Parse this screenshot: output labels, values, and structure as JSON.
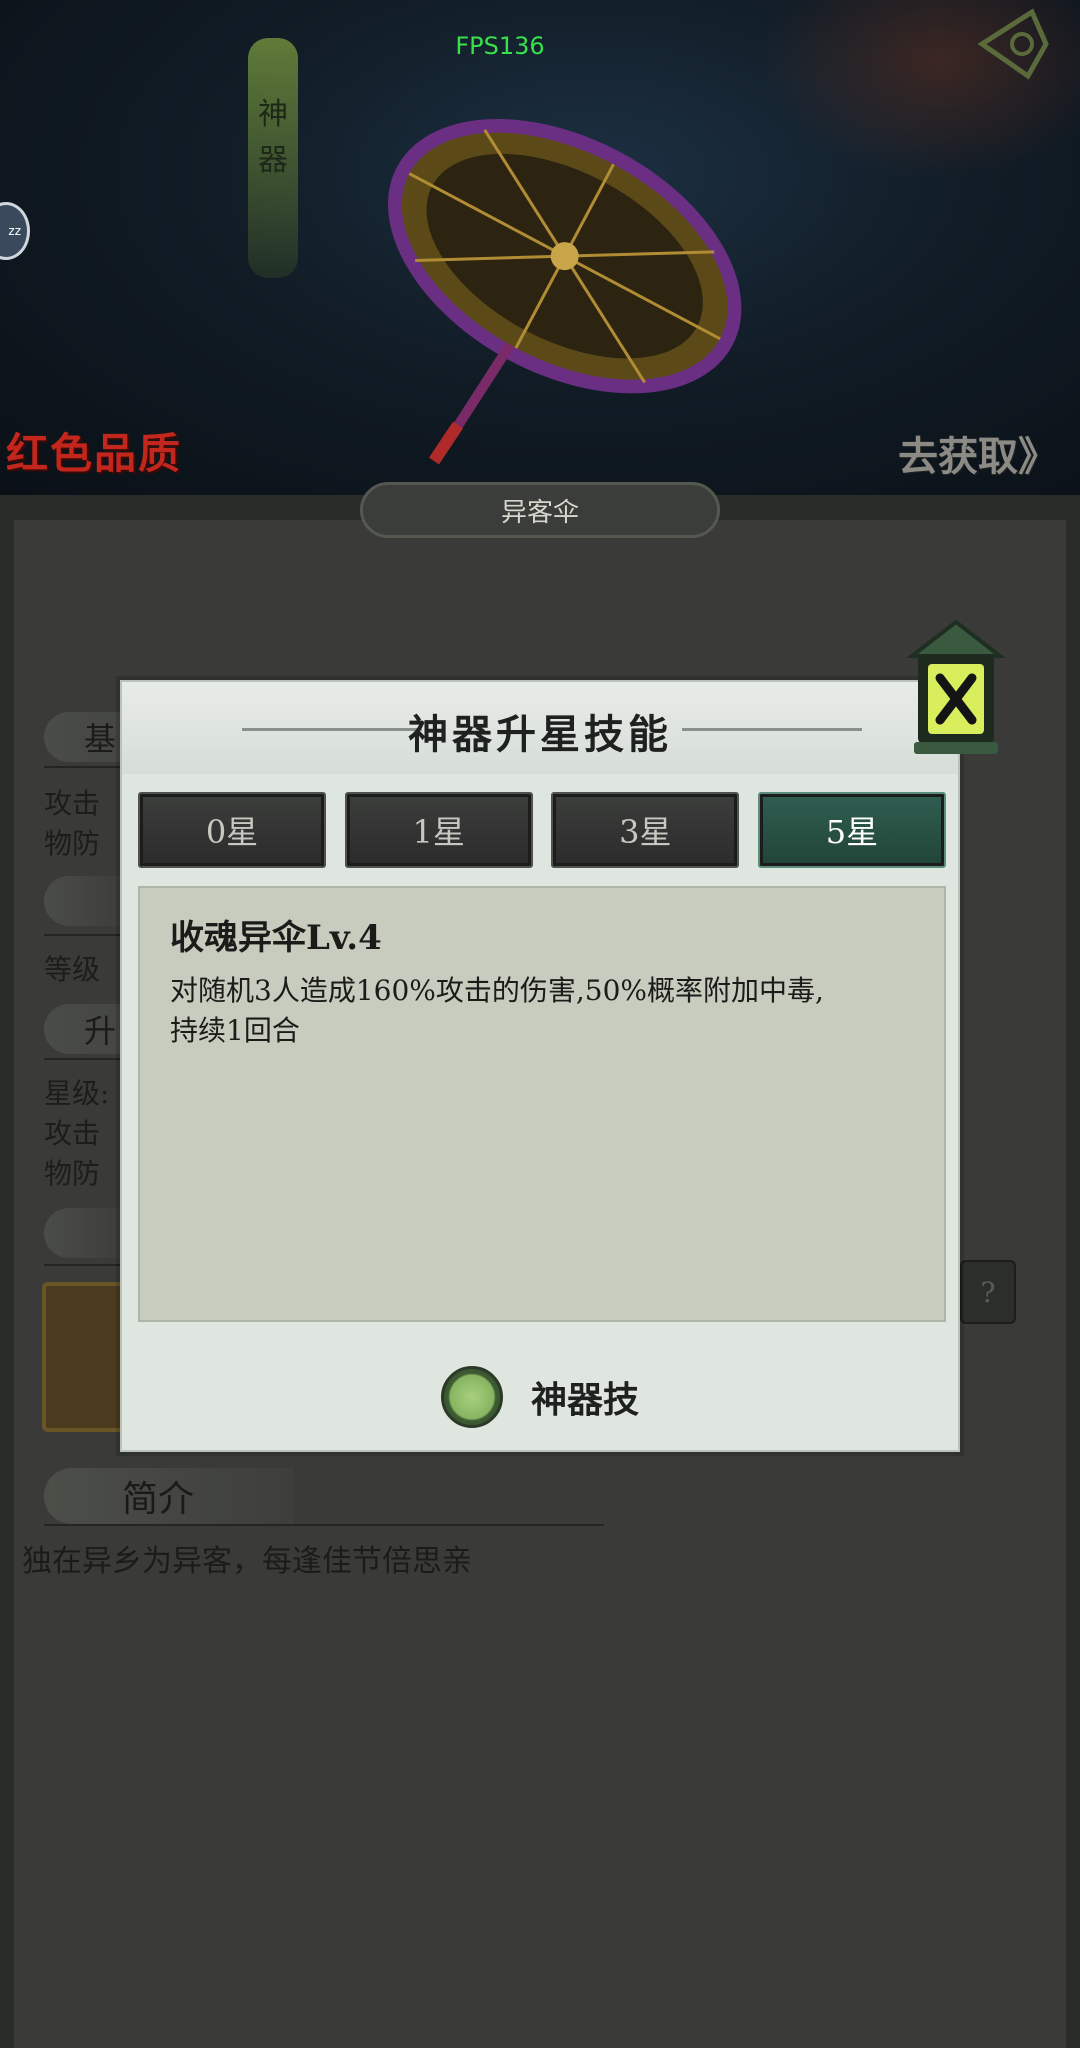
{
  "hud": {
    "fps": "FPS136"
  },
  "artwork": {
    "banner": [
      "神",
      "器"
    ],
    "quality_label": "红色品质",
    "go_get_label": "去获取》",
    "item_name": "异客伞"
  },
  "background": {
    "section_base": "基",
    "section_upgrade": "升",
    "labels": {
      "attack1": "攻击",
      "phys_def1": "物防",
      "level": "等级",
      "star_level": "星级:",
      "attack2": "攻击",
      "phys_def2": "物防"
    },
    "help_icon": "?",
    "intro_title": "简介",
    "intro_text": "独在异乡为异客，每逢佳节倍思亲"
  },
  "modal": {
    "title": "神器升星技能",
    "tabs": [
      {
        "label": "0星",
        "active": false
      },
      {
        "label": "1星",
        "active": false
      },
      {
        "label": "3星",
        "active": false
      },
      {
        "label": "5星",
        "active": true
      }
    ],
    "skill": {
      "name": "收魂异伞Lv.4",
      "description_line1": "对随机3人造成160%攻击的伤害,50%概率附加中毒,",
      "description_line2": "持续1回合"
    },
    "legend_label": "神器技",
    "close_icon": "close-lantern-icon"
  },
  "colors": {
    "active_tab": "#2f5e50",
    "quality_red": "#c2261c",
    "fps_green": "#38e04a",
    "legend_green": "#88b562"
  }
}
